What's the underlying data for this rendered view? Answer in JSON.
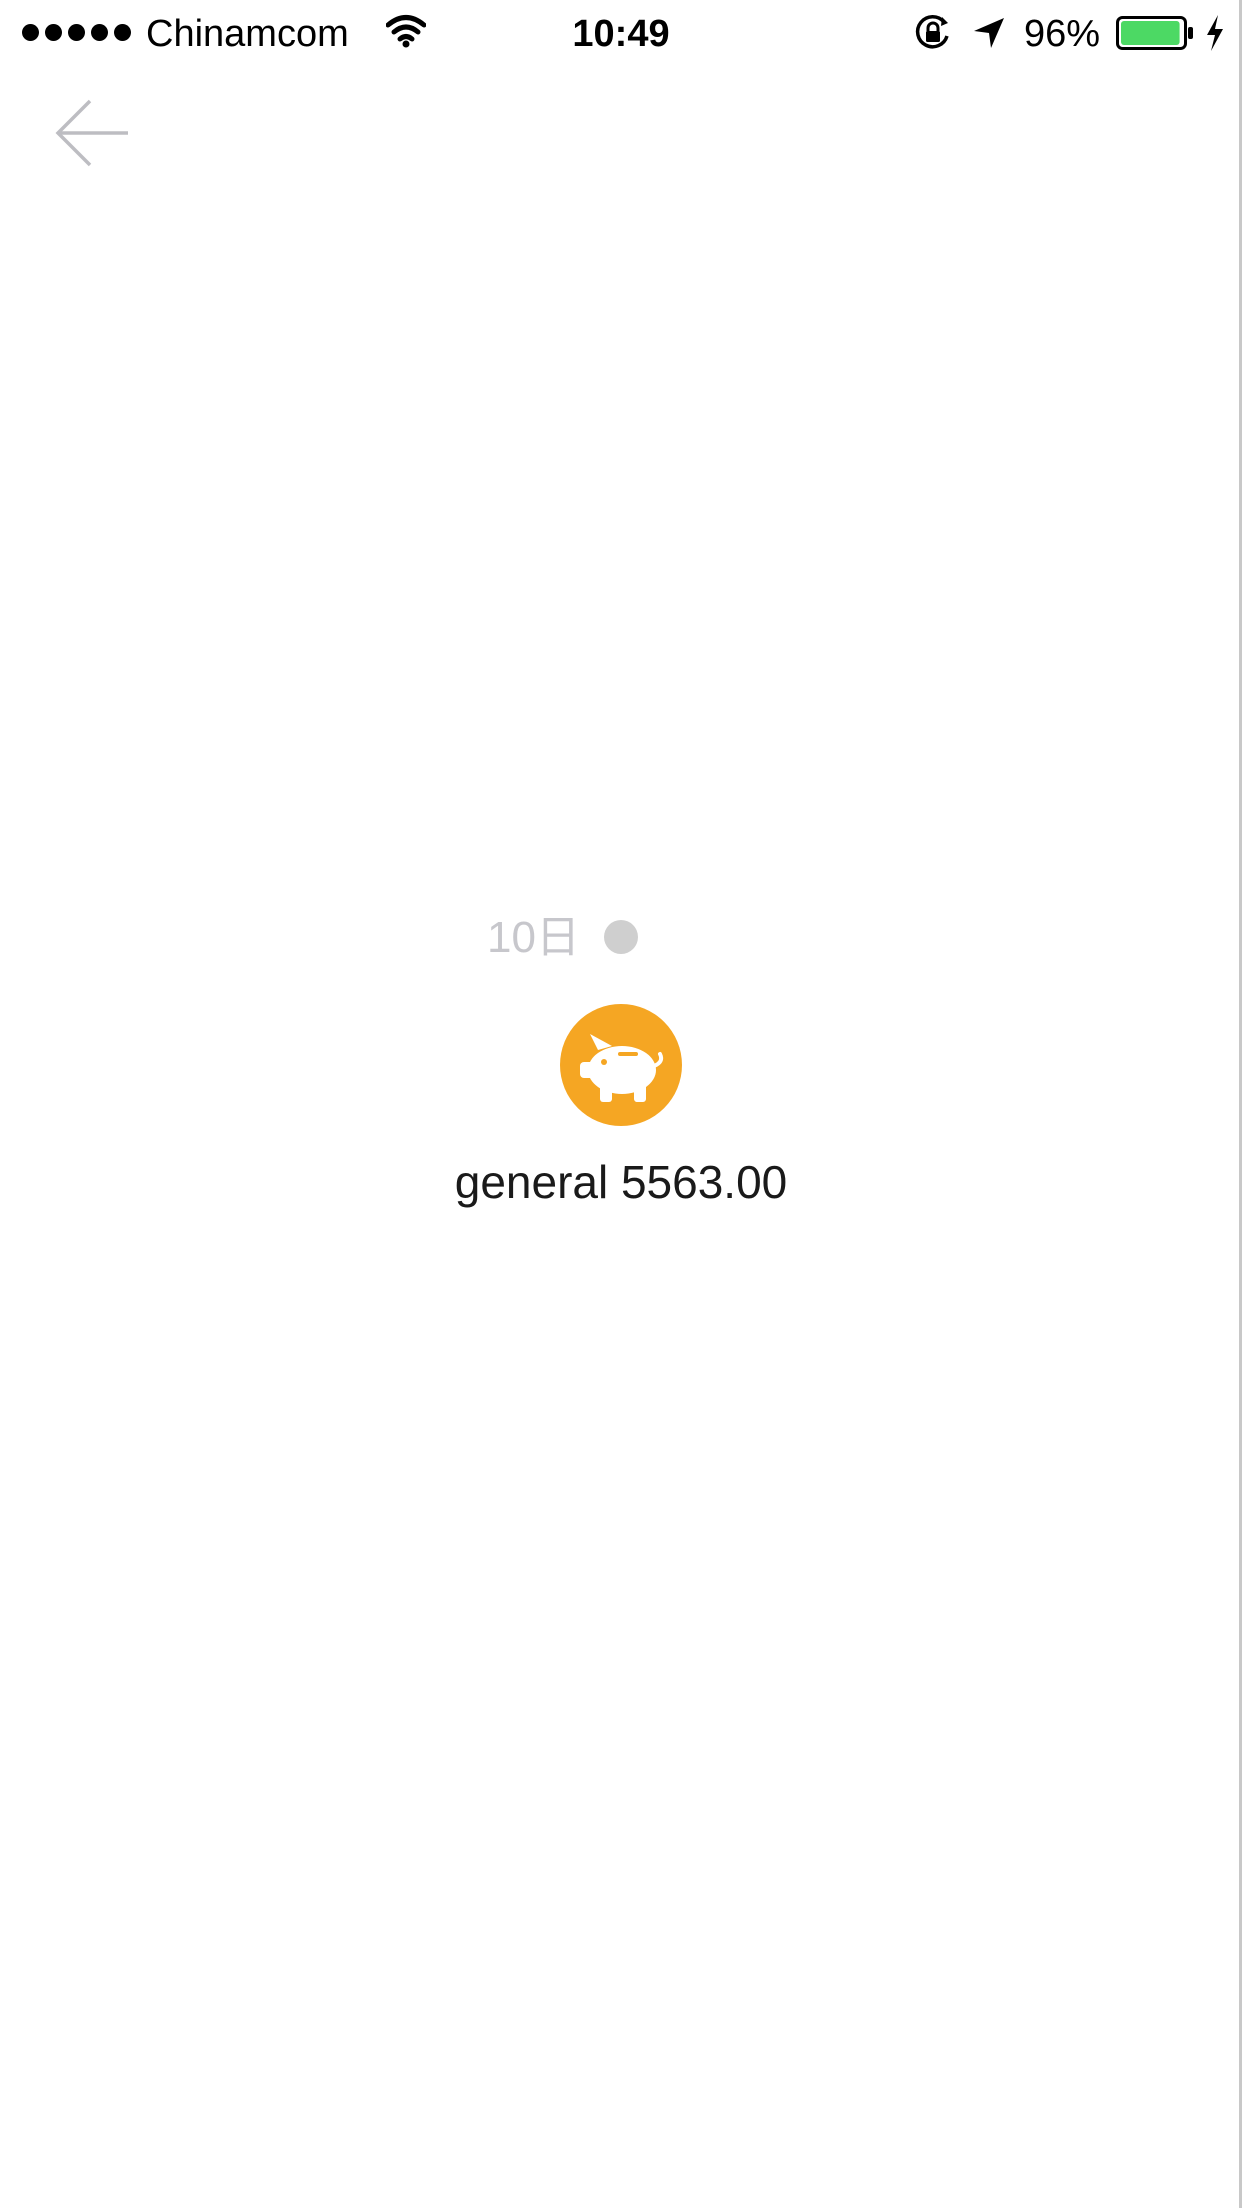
{
  "status_bar": {
    "carrier": "Chinamcom",
    "time": "10:49",
    "battery_percent": "96%",
    "battery_level": 0.96,
    "battery_color": "#4cd964"
  },
  "nav": {
    "back_icon": "arrow-left-icon"
  },
  "entry": {
    "date": "10日",
    "category_icon": "piggy-bank-icon",
    "category_color": "#f5a623",
    "label": "general 5563.00"
  }
}
